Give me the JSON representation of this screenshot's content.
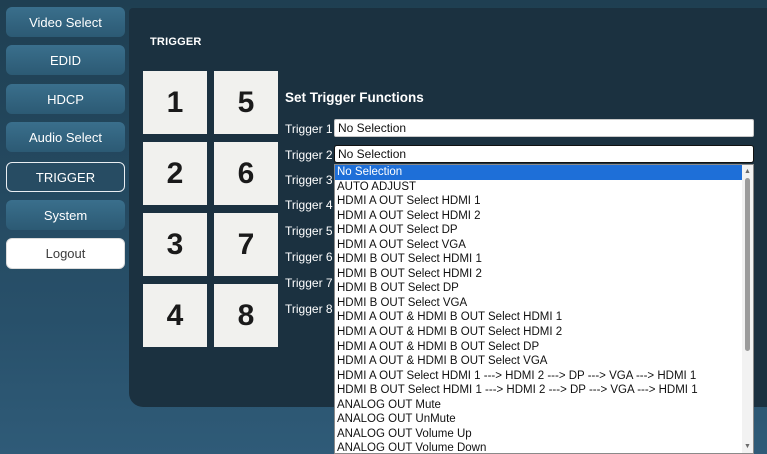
{
  "sidebar": {
    "items": [
      {
        "label": "Video Select"
      },
      {
        "label": "EDID"
      },
      {
        "label": "HDCP"
      },
      {
        "label": "Audio Select"
      },
      {
        "label": "TRIGGER"
      },
      {
        "label": "System"
      },
      {
        "label": "Logout"
      }
    ],
    "active": "TRIGGER"
  },
  "main": {
    "section_title": "TRIGGER",
    "tiles": [
      "1",
      "5",
      "2",
      "6",
      "3",
      "7",
      "4",
      "8"
    ],
    "heading": "Set Trigger Functions",
    "triggers": [
      {
        "label": "Trigger 1",
        "value": "No Selection"
      },
      {
        "label": "Trigger 2",
        "value": "No Selection"
      },
      {
        "label": "Trigger 3"
      },
      {
        "label": "Trigger 4"
      },
      {
        "label": "Trigger 5"
      },
      {
        "label": "Trigger 6"
      },
      {
        "label": "Trigger 7"
      },
      {
        "label": "Trigger 8"
      }
    ]
  },
  "dropdown": {
    "selected": "No Selection",
    "options": [
      "No Selection",
      "AUTO ADJUST",
      "HDMI A OUT Select HDMI 1",
      "HDMI A OUT Select HDMI 2",
      "HDMI A OUT Select DP",
      "HDMI A OUT Select VGA",
      "HDMI B OUT Select HDMI 1",
      "HDMI B OUT Select HDMI 2",
      "HDMI B OUT Select DP",
      "HDMI B OUT Select VGA",
      "HDMI A OUT & HDMI B OUT Select HDMI 1",
      "HDMI A OUT & HDMI B OUT Select HDMI 2",
      "HDMI A OUT & HDMI B OUT Select DP",
      "HDMI A OUT & HDMI B OUT Select VGA",
      "HDMI A OUT Select HDMI 1 ---> HDMI 2 ---> DP ---> VGA ---> HDMI 1",
      "HDMI B OUT Select HDMI 1 ---> HDMI 2 ---> DP ---> VGA ---> HDMI 1",
      "ANALOG OUT Mute",
      "ANALOG OUT UnMute",
      "ANALOG OUT Volume Up",
      "ANALOG OUT Volume Down"
    ],
    "icons": {
      "up": "scroll-up-arrow-icon",
      "down": "scroll-down-arrow-icon"
    }
  },
  "colors": {
    "background": "#28506a",
    "panel": "#1b3140",
    "nav_button": "#3a6f8c",
    "selection": "#1e6fd8"
  }
}
